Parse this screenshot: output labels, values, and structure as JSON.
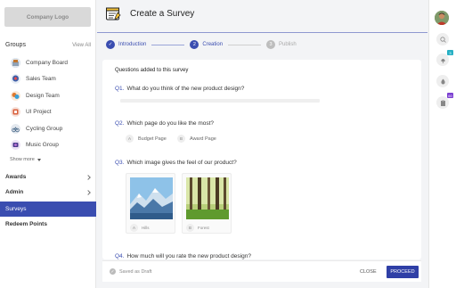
{
  "sidebar": {
    "logo_text": "Company Logo",
    "groups_title": "Groups",
    "view_all": "View All",
    "groups": [
      {
        "label": "Company Board",
        "color": "#9aa9b8"
      },
      {
        "label": "Sales Team",
        "color": "#3d5fa8"
      },
      {
        "label": "Design Team",
        "color": "#e07a2e"
      },
      {
        "label": "UI Project",
        "color": "#d95f3b"
      },
      {
        "label": "Cycling Group",
        "color": "#9aa9b8"
      },
      {
        "label": "Music Group",
        "color": "#b56fd1"
      }
    ],
    "show_more": "Show more",
    "menu": [
      {
        "label": "Awards"
      },
      {
        "label": "Admin"
      },
      {
        "label": "Surveys"
      },
      {
        "label": "Redeem Points"
      }
    ]
  },
  "header": {
    "title": "Create a Survey",
    "icon": "survey-form-icon"
  },
  "stepper": {
    "steps": [
      {
        "label": "Introduction",
        "num": "✓",
        "state": "done"
      },
      {
        "label": "Creation",
        "num": "2",
        "state": "active"
      },
      {
        "label": "Publish",
        "num": "3",
        "state": "pending"
      }
    ]
  },
  "survey": {
    "section_title": "Questions added to this survey",
    "q1": {
      "num": "Q1.",
      "text": "What do you think of the new product design?"
    },
    "q2": {
      "num": "Q2.",
      "text": "Which page do you like the most?",
      "options": [
        {
          "letter": "A",
          "label": "Budget Page"
        },
        {
          "letter": "B",
          "label": "Award Page"
        }
      ]
    },
    "q3": {
      "num": "Q3.",
      "text": "Which image gives the feel of our product?",
      "options": [
        {
          "letter": "A",
          "label": "Hills"
        },
        {
          "letter": "B",
          "label": "Forest"
        }
      ]
    },
    "q4": {
      "num": "Q4.",
      "text": "How much will you rate the new product design?"
    }
  },
  "footer": {
    "draft_status": "Saved as Draft",
    "close_label": "CLOSE",
    "proceed_label": "PROCEED"
  },
  "rail": {
    "badge_notifications": "3",
    "badge_tasks": "60"
  },
  "colors": {
    "accent": "#3a4db0",
    "badge_teal": "#27b0c4",
    "badge_purple": "#7b3fd1"
  }
}
